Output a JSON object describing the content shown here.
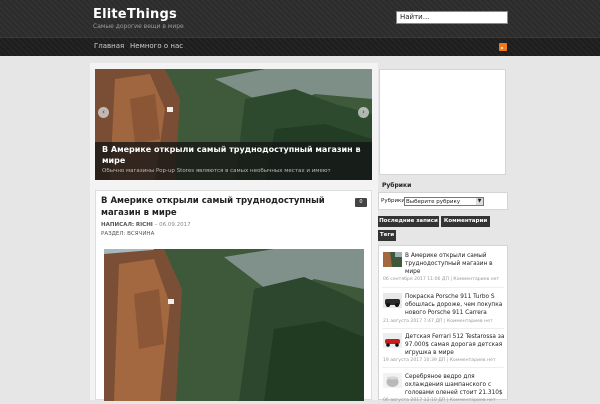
{
  "site": {
    "title": "EliteThings",
    "tagline": "Самые дорогие вещи в мире"
  },
  "search": {
    "value": "Найти..."
  },
  "nav": {
    "home": "Главная",
    "about": "Немного о нас"
  },
  "slider": {
    "title": "В Америке открыли самый труднодоступный магазин в мире",
    "excerpt": "Обычно магазины Pop-up Stores являются в самых необычных местах и имеют"
  },
  "post": {
    "title": "В Америке открыли самый труднодоступный магазин в мире",
    "comments": "0",
    "meta_label": "НАПИСАЛ:",
    "author": "RICHI",
    "date": "– 06.09.2017",
    "category": "РАЗДЕЛ: ВСЯЧИНА"
  },
  "sidebar": {
    "rubrics_title": "Рубрики",
    "rubrics_label": "Рубрики",
    "rubrics_select": "Выберите рубрику",
    "tabs": [
      "Последние записи",
      "Комментарии",
      "Теги"
    ],
    "recent": [
      {
        "title": "В Америке открыли самый труднодоступный магазин в мире",
        "meta": "06 сентября 2017 11:06 ДП | Комментариев нет"
      },
      {
        "title": "Покраска Porsche 911 Turbo S обошлась дороже, чем покупка нового Porsche 911 Carrera",
        "meta": "21 августа 2017 7:47 ДП | Комментариев нет"
      },
      {
        "title": "Детская Ferrari 512 Testarossa за 97.000$ самая дорогая детская игрушка в мире",
        "meta": "19 августа 2017 10:39 ДП | Комментариев нет"
      },
      {
        "title": "Серебряное ведро для охлаждения шампанского с головами оленей стоит 21.310$",
        "meta": "06 августа 2017 12:10 ДП | Комментариев нет"
      }
    ]
  }
}
